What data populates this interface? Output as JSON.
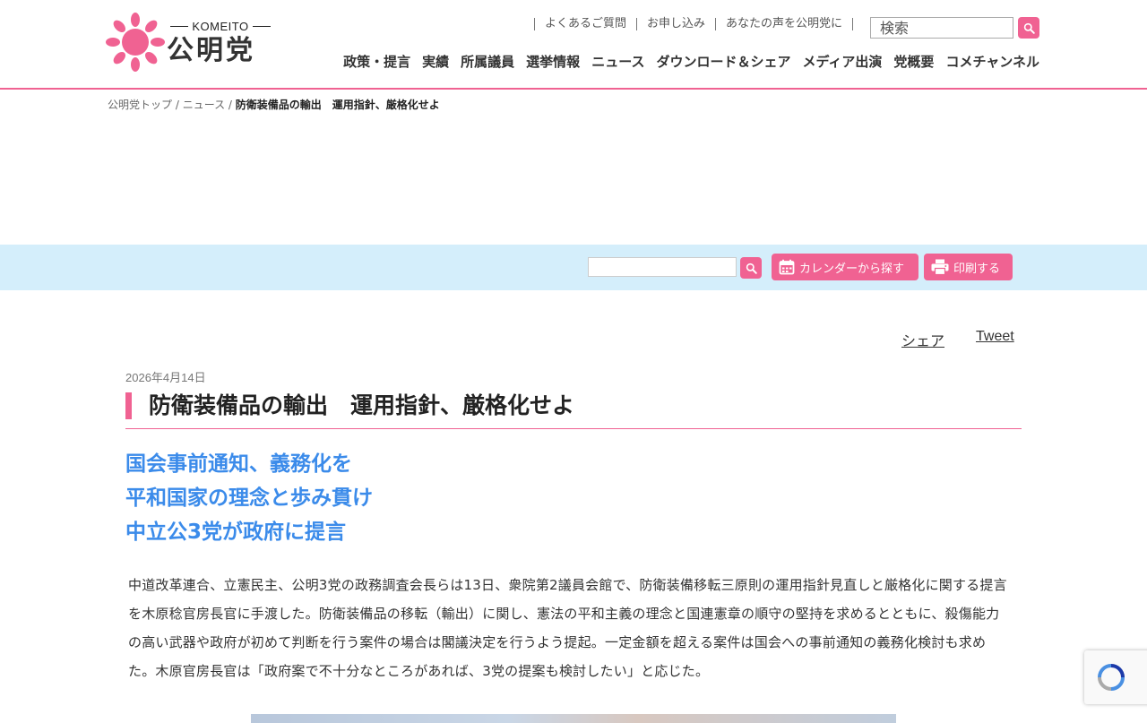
{
  "brand": {
    "latin": "KOMEITO",
    "name": "公明党",
    "color": "#f06292"
  },
  "util_links": [
    "よくあるご質問",
    "お申し込み",
    "あなたの声を公明党に"
  ],
  "search": {
    "placeholder": "検索"
  },
  "nav": [
    "政策・提言",
    "実績",
    "所属議員",
    "選挙情報",
    "ニュース",
    "ダウンロード＆シェア",
    "メディア出演",
    "党概要",
    "コメチャンネル"
  ],
  "breadcrumb": {
    "home": "公明党トップ",
    "sep": " / ",
    "section": "ニュース",
    "current": "防衛装備品の輸出　運用指針、厳格化せよ"
  },
  "toolbar": {
    "calendar_label": "カレンダーから探す",
    "print_label": "印刷する",
    "background": "#d4eefb"
  },
  "share": {
    "facebook": "シェア",
    "twitter": "Tweet"
  },
  "article": {
    "date": "2026年4月14日",
    "title": "防衛装備品の輸出　運用指針、厳格化せよ",
    "subtitles": [
      "国会事前通知、義務化を",
      "平和国家の理念と歩み貫け",
      "中立公3党が政府に提言"
    ],
    "body": "中道改革連合、立憲民主、公明3党の政務調査会長らは13日、衆院第2議員会館で、防衛装備移転三原則の運用指針見直しと厳格化に関する提言を木原稔官房長官に手渡した。防衛装備品の移転（輸出）に関し、憲法の平和主義の理念と国連憲章の順守の堅持を求めるとともに、殺傷能力の高い武器や政府が初めて判断を行う案件の場合は閣議決定を行うよう提起。一定金額を超える案件は国会への事前通知の義務化検討も求めた。木原官房長官は「政府案で不十分なところがあれば、3党の提案も検討したい」と応じた。",
    "subtitle_color": "#3b8bea"
  }
}
